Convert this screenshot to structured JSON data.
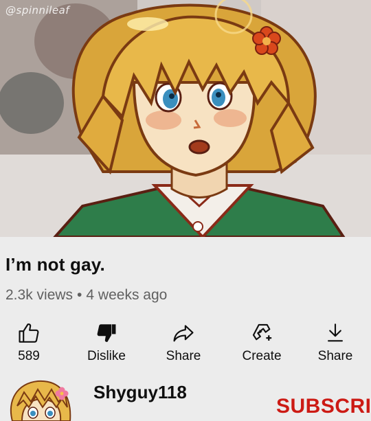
{
  "art": {
    "watermark": "@spinnileaf",
    "colors": {
      "hair": "#e8b84a",
      "hair_outline": "#7a3a12",
      "vest": "#2e7d4a",
      "shirt": "#f3efe9",
      "eyes": "#3a8fbf",
      "flower": "#d9481c"
    }
  },
  "video": {
    "title": "I’m not gay.",
    "views": "2.3k views",
    "separator": "•",
    "age": "4 weeks ago"
  },
  "actions": [
    {
      "icon": "thumbs-up-icon",
      "label": "589"
    },
    {
      "icon": "thumbs-down-icon",
      "label": "Dislike"
    },
    {
      "icon": "share-arrow-icon",
      "label": "Share"
    },
    {
      "icon": "create-icon",
      "label": "Create"
    },
    {
      "icon": "download-icon",
      "label": "Share"
    }
  ],
  "channel": {
    "name": "Shyguy118",
    "subscribe_label": "SUBSCRI"
  },
  "colors": {
    "background": "#ececec",
    "text": "#0f0f0f",
    "secondary_text": "#606060",
    "subscribe": "#cc1a14"
  }
}
